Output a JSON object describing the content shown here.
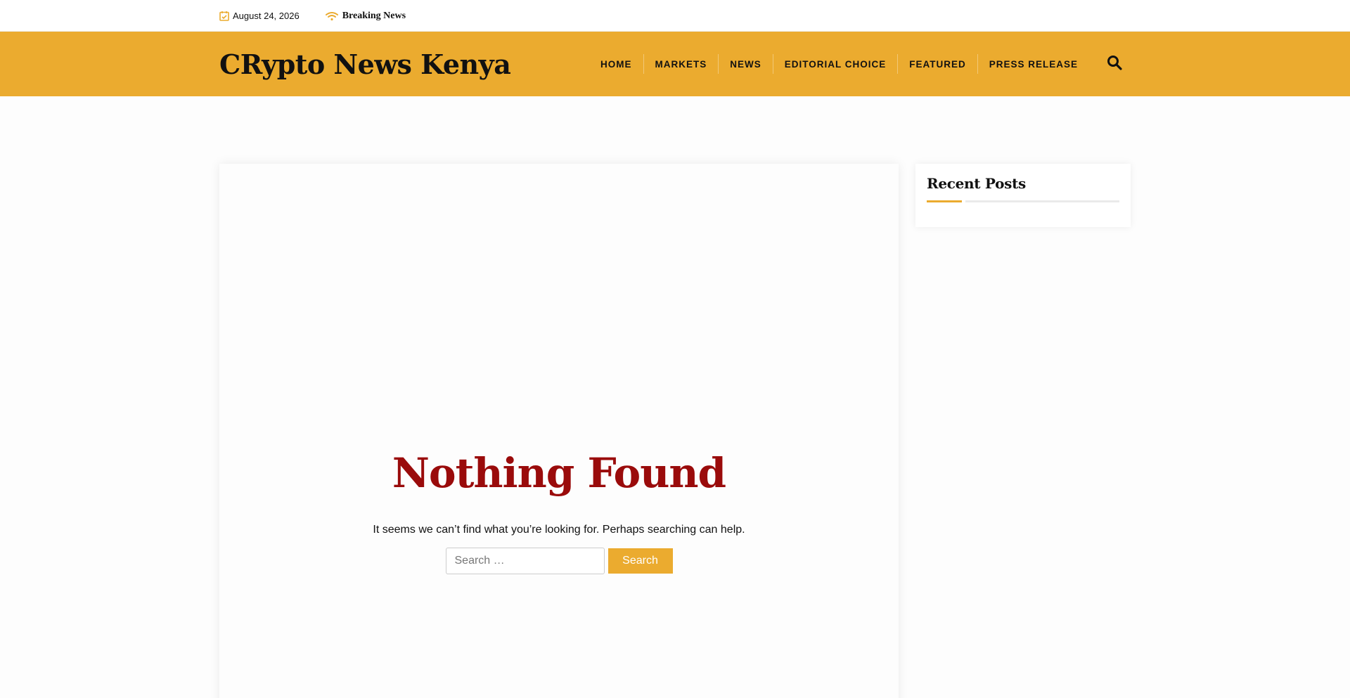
{
  "topbar": {
    "date": "August 24, 2026",
    "breaking_label": "Breaking News",
    "icons": [
      "calendar-icon",
      "wifi-signal-icon"
    ]
  },
  "header": {
    "site_title": "CRypto News Kenya",
    "nav": [
      "HOME",
      "MARKETS",
      "NEWS",
      "EDITORIAL CHOICE",
      "FEATURED",
      "PRESS RELEASE"
    ],
    "search_icon": "search-icon"
  },
  "main": {
    "title": "Nothing Found",
    "message": "It seems we can’t find what you’re looking for. Perhaps searching can help.",
    "search_placeholder": "Search …",
    "search_button": "Search"
  },
  "sidebar": {
    "widget_title": "Recent Posts"
  },
  "colors": {
    "accent": "#ebab2f",
    "title_red": "#9a0b0b",
    "text": "#111111"
  }
}
